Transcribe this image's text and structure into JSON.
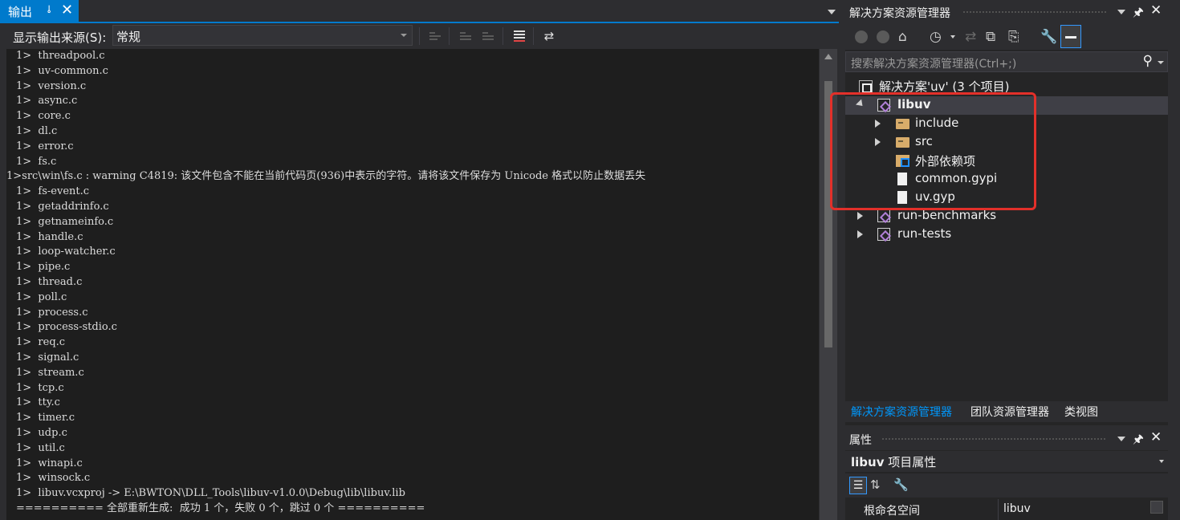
{
  "output": {
    "tab_title": "输出",
    "source_label": "显示输出来源(S):",
    "source_value": "常规",
    "lines": [
      "1>  threadpool.c",
      "1>  uv-common.c",
      "1>  version.c",
      "1>  async.c",
      "1>  core.c",
      "1>  dl.c",
      "1>  error.c",
      "1>  fs.c",
      "1>src\\win\\fs.c : warning C4819: 该文件包含不能在当前代码页(936)中表示的字符。请将该文件保存为 Unicode 格式以防止数据丢失",
      "1>  fs-event.c",
      "1>  getaddrinfo.c",
      "1>  getnameinfo.c",
      "1>  handle.c",
      "1>  loop-watcher.c",
      "1>  pipe.c",
      "1>  thread.c",
      "1>  poll.c",
      "1>  process.c",
      "1>  process-stdio.c",
      "1>  req.c",
      "1>  signal.c",
      "1>  stream.c",
      "1>  tcp.c",
      "1>  tty.c",
      "1>  timer.c",
      "1>  udp.c",
      "1>  util.c",
      "1>  winapi.c",
      "1>  winsock.c",
      "1>  libuv.vcxproj -> E:\\BWTON\\DLL_Tools\\libuv-v1.0.0\\Debug\\lib\\libuv.lib",
      "========== 全部重新生成:  成功 1 个，失败 0 个，跳过 0 个 =========="
    ]
  },
  "solution_explorer": {
    "title": "解决方案资源管理器",
    "search_placeholder": "搜索解决方案资源管理器(Ctrl+;)",
    "solution_label": "解决方案'uv' (3 个项目)",
    "tree": [
      {
        "label": "libuv",
        "type": "project",
        "depth": 0,
        "expanded": true,
        "selected": true
      },
      {
        "label": "include",
        "type": "folder",
        "depth": 1,
        "expanded": false
      },
      {
        "label": "src",
        "type": "folder",
        "depth": 1,
        "expanded": false
      },
      {
        "label": "外部依赖项",
        "type": "refs",
        "depth": 1
      },
      {
        "label": "common.gypi",
        "type": "file",
        "depth": 1
      },
      {
        "label": "uv.gyp",
        "type": "file",
        "depth": 1
      },
      {
        "label": "run-benchmarks",
        "type": "project",
        "depth": 0,
        "expanded": false
      },
      {
        "label": "run-tests",
        "type": "project",
        "depth": 0,
        "expanded": false
      }
    ],
    "bottom_tabs": [
      "解决方案资源管理器",
      "团队资源管理器",
      "类视图"
    ]
  },
  "properties": {
    "title": "属性",
    "object_name": "libuv",
    "object_type": "项目属性",
    "rows": [
      {
        "name": "根命名空间",
        "value": "libuv"
      }
    ]
  },
  "colors": {
    "accent": "#007acc",
    "highlight_box": "#e3302a",
    "background": "#2d2d30",
    "editor_background": "#1e1e1e"
  }
}
